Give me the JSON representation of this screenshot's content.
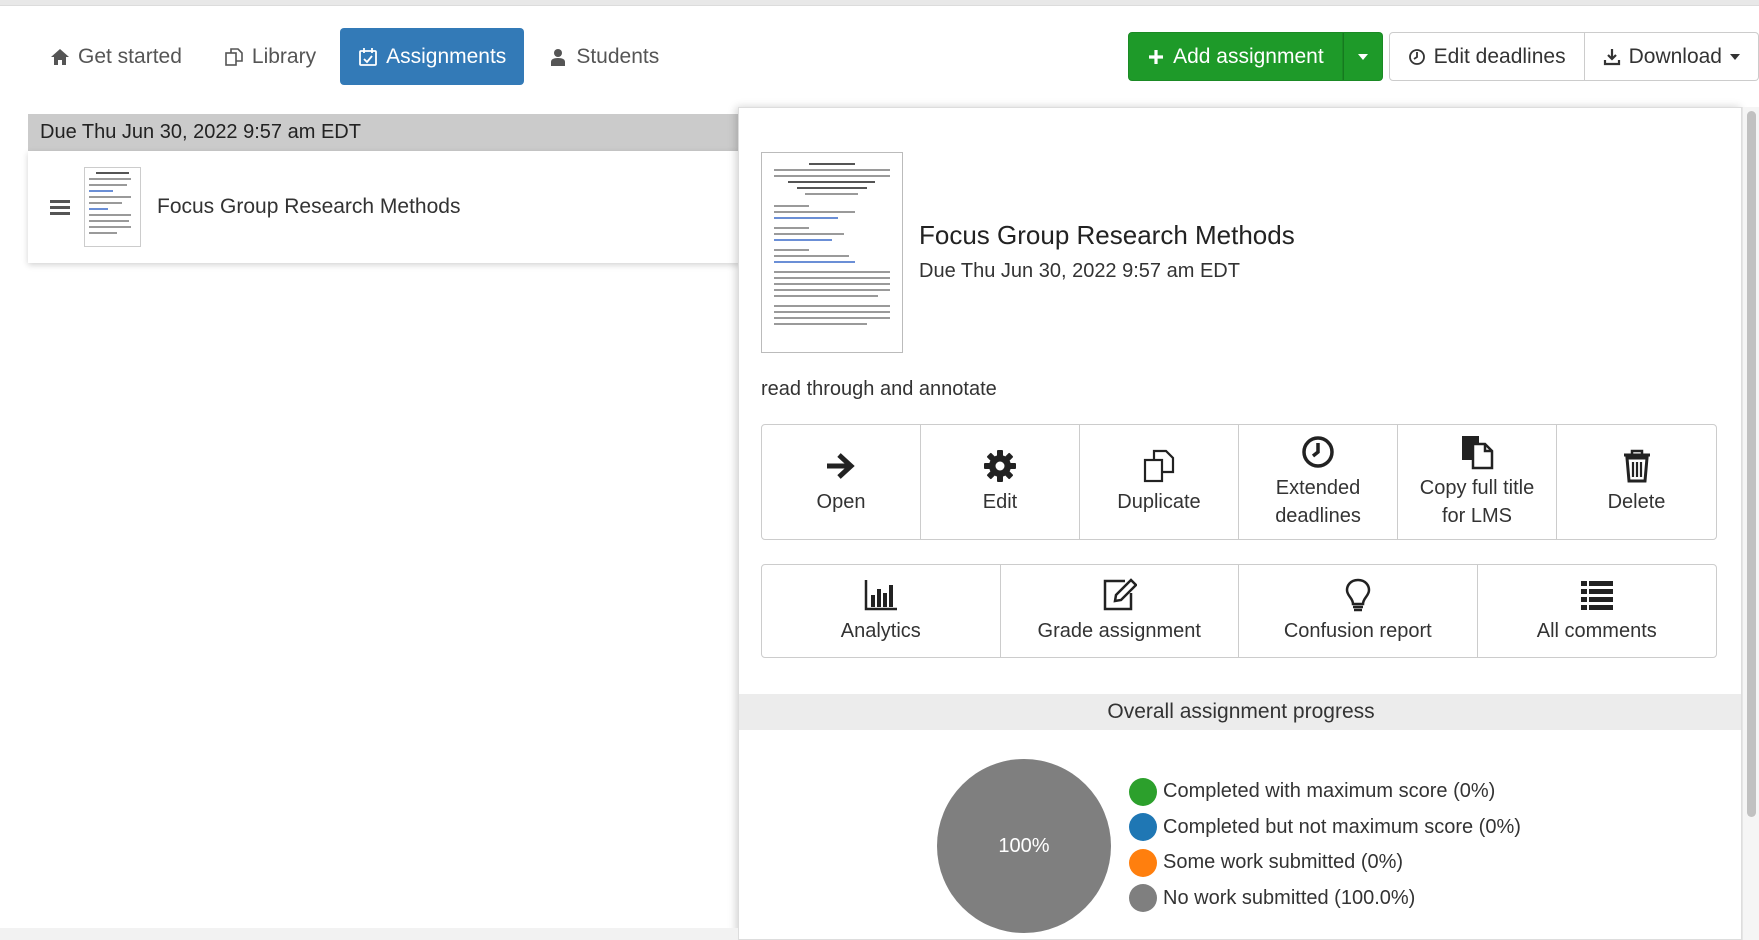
{
  "nav": {
    "tabs": [
      {
        "label": "Get started",
        "icon": "home-icon"
      },
      {
        "label": "Library",
        "icon": "copy-icon"
      },
      {
        "label": "Assignments",
        "icon": "calendar-check-icon",
        "active": true
      },
      {
        "label": "Students",
        "icon": "user-icon"
      }
    ]
  },
  "toolbar": {
    "add_label": "Add assignment",
    "edit_deadlines_label": "Edit deadlines",
    "download_label": "Download"
  },
  "list": {
    "due_header": "Due Thu Jun 30, 2022 9:57 am EDT",
    "items": [
      {
        "title": "Focus Group Research Methods"
      }
    ]
  },
  "detail": {
    "title": "Focus Group Research Methods",
    "due": "Due Thu Jun 30, 2022 9:57 am EDT",
    "description": "read through and annotate",
    "actions_row1": [
      {
        "label": "Open",
        "icon": "arrow-right-icon"
      },
      {
        "label": "Edit",
        "icon": "gear-icon"
      },
      {
        "label": "Duplicate",
        "icon": "copy-icon"
      },
      {
        "label": "Extended deadlines",
        "label_lines": [
          "Extended",
          "deadlines"
        ],
        "icon": "clock-icon"
      },
      {
        "label": "Copy full title for LMS",
        "label_lines": [
          "Copy full title",
          "for LMS"
        ],
        "icon": "files-icon"
      },
      {
        "label": "Delete",
        "icon": "trash-icon"
      }
    ],
    "actions_row2": [
      {
        "label": "Analytics",
        "icon": "bar-chart-icon"
      },
      {
        "label": "Grade assignment",
        "icon": "edit-square-icon"
      },
      {
        "label": "Confusion report",
        "icon": "lightbulb-icon"
      },
      {
        "label": "All comments",
        "icon": "list-icon"
      }
    ]
  },
  "progress": {
    "title": "Overall assignment progress",
    "pie_label": "100%",
    "legend": [
      {
        "label": "Completed with maximum score (0%)",
        "color": "#2ca02c",
        "value": 0
      },
      {
        "label": "Completed but not maximum score (0%)",
        "color": "#1f77b4",
        "value": 0
      },
      {
        "label": "Some work submitted (0%)",
        "color": "#ff7f0e",
        "value": 0
      },
      {
        "label": "No work submitted (100.0%)",
        "color": "#7f7f7f",
        "value": 100
      }
    ]
  },
  "colors": {
    "primary": "#337ab7",
    "success": "#1e9a29"
  }
}
